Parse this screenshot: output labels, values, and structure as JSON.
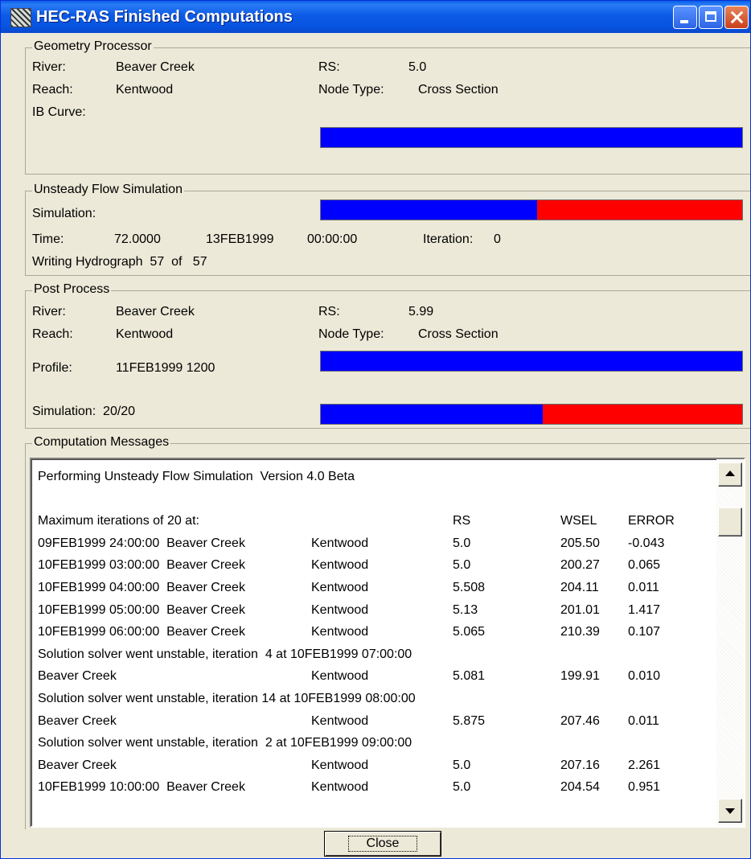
{
  "window": {
    "title": "HEC-RAS Finished Computations"
  },
  "geometry": {
    "group_label": "Geometry Processor",
    "river_label": "River:",
    "river": "Beaver Creek",
    "reach_label": "Reach:",
    "reach": "Kentwood",
    "ib_curve_label": "IB Curve:",
    "rs_label": "RS:",
    "rs": "5.0",
    "node_type_label": "Node Type:",
    "node_type": "Cross Section",
    "progress": 1.0
  },
  "unsteady": {
    "group_label": "Unsteady Flow Simulation",
    "simulation_label": "Simulation:",
    "time_label": "Time:",
    "time_value": "72.0000",
    "date": "13FEB1999",
    "clock": "00:00:00",
    "iteration_label": "Iteration:",
    "iteration": "0",
    "hydrograph_text": "Writing Hydrograph  57  of   57",
    "progress": 0.513
  },
  "post": {
    "group_label": "Post Process",
    "river_label": "River:",
    "river": "Beaver Creek",
    "reach_label": "Reach:",
    "reach": "Kentwood",
    "profile_label": "Profile:",
    "profile": "11FEB1999 1200",
    "rs_label": "RS:",
    "rs": "5.99",
    "node_type_label": "Node Type:",
    "node_type": "Cross Section",
    "profile_progress": 1.0,
    "simulation_text": "Simulation:  20/20",
    "simulation_progress": 0.526
  },
  "messages": {
    "group_label": "Computation Messages",
    "lines": [
      {
        "c1": "Performing Unsteady Flow Simulation  Version 4.0 Beta"
      },
      {
        "c1": ""
      },
      {
        "c1": "Maximum iterations of 20 at:",
        "rs": "RS",
        "wsel": "WSEL",
        "err": "ERROR"
      },
      {
        "c1": "09FEB1999 24:00:00  Beaver Creek",
        "reach": "Kentwood",
        "rs": "5.0",
        "wsel": "205.50",
        "err": "-0.043"
      },
      {
        "c1": "10FEB1999 03:00:00  Beaver Creek",
        "reach": "Kentwood",
        "rs": "5.0",
        "wsel": "200.27",
        "err": "0.065"
      },
      {
        "c1": "10FEB1999 04:00:00  Beaver Creek",
        "reach": "Kentwood",
        "rs": "5.508",
        "wsel": "204.11",
        "err": "0.011"
      },
      {
        "c1": "10FEB1999 05:00:00  Beaver Creek",
        "reach": "Kentwood",
        "rs": "5.13",
        "wsel": "201.01",
        "err": "1.417"
      },
      {
        "c1": "10FEB1999 06:00:00  Beaver Creek",
        "reach": "Kentwood",
        "rs": "5.065",
        "wsel": "210.39",
        "err": "0.107"
      },
      {
        "c1": "Solution solver went unstable, iteration  4 at 10FEB1999 07:00:00"
      },
      {
        "c1": "Beaver Creek",
        "reach": "Kentwood",
        "rs": "5.081",
        "wsel": "199.91",
        "err": "0.010"
      },
      {
        "c1": "Solution solver went unstable, iteration 14 at 10FEB1999 08:00:00"
      },
      {
        "c1": "Beaver Creek",
        "reach": "Kentwood",
        "rs": "5.875",
        "wsel": "207.46",
        "err": "0.011"
      },
      {
        "c1": "Solution solver went unstable, iteration  2 at 10FEB1999 09:00:00"
      },
      {
        "c1": "Beaver Creek",
        "reach": "Kentwood",
        "rs": "5.0",
        "wsel": "207.16",
        "err": "2.261"
      },
      {
        "c1": "10FEB1999 10:00:00  Beaver Creek",
        "reach": "Kentwood",
        "rs": "5.0",
        "wsel": "204.54",
        "err": "0.951"
      }
    ]
  },
  "close_label": "Close"
}
